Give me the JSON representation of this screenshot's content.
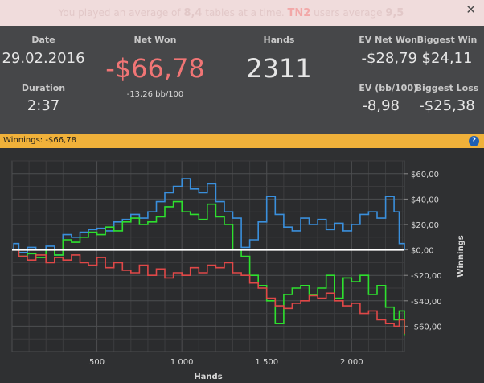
{
  "banner": {
    "pre": "You played an average of ",
    "avg_tables": "8,4",
    "mid": " tables at a time. ",
    "site": "TN2",
    "post": " users average ",
    "site_avg": "9,5"
  },
  "icons": {
    "close": "close-icon",
    "help": "help-icon"
  },
  "stats": {
    "date_label": "Date",
    "date": "29.02.2016",
    "duration_label": "Duration",
    "duration": "2:37",
    "net_won_label": "Net Won",
    "net_won": "-$66,78",
    "bb100": "-13,26 bb/100",
    "hands_label": "Hands",
    "hands": "2311",
    "ev_net_won_label": "EV Net Won",
    "ev_net_won": "-$28,79",
    "biggest_win_label": "Biggest Win",
    "biggest_win": "$24,11",
    "ev_bb_label": "EV (bb/100)",
    "ev_bb": "-8,98",
    "biggest_loss_label": "Biggest Loss",
    "biggest_loss": "-$25,38"
  },
  "winnings_bar": {
    "label": "Winnings:",
    "value": "-$66,78"
  },
  "colors": {
    "loss": "#f07575",
    "accent_bar": "#f0b13a",
    "blue": "#3a8fdc",
    "green": "#2ee02e",
    "red": "#e04848"
  },
  "chart_data": {
    "type": "line",
    "xlabel": "Hands",
    "ylabel": "Winnings",
    "xlim": [
      0,
      2311
    ],
    "ylim": [
      -80,
      70
    ],
    "x_ticks": [
      500,
      1000,
      1500,
      2000
    ],
    "x_tick_labels": [
      "500",
      "1 000",
      "1 500",
      "2 000"
    ],
    "y_ticks": [
      60,
      40,
      20,
      0,
      -20,
      -40,
      -60
    ],
    "y_tick_labels": [
      "$60,00",
      "$40,00",
      "$20,00",
      "$0,00",
      "-$20,00",
      "-$40,00",
      "-$60,00"
    ],
    "series": [
      {
        "color": "#3a8fdc",
        "x": [
          0,
          10,
          40,
          90,
          140,
          200,
          250,
          300,
          350,
          400,
          450,
          500,
          550,
          600,
          650,
          700,
          750,
          800,
          850,
          900,
          950,
          1000,
          1050,
          1100,
          1150,
          1200,
          1250,
          1300,
          1350,
          1400,
          1450,
          1500,
          1550,
          1600,
          1650,
          1700,
          1750,
          1800,
          1850,
          1900,
          1950,
          2000,
          2050,
          2100,
          2150,
          2200,
          2250,
          2280,
          2311
        ],
        "y": [
          0,
          5,
          -2,
          2,
          0,
          3,
          -4,
          12,
          10,
          14,
          16,
          17,
          15,
          22,
          24,
          28,
          25,
          30,
          38,
          45,
          50,
          56,
          48,
          45,
          52,
          38,
          30,
          25,
          2,
          8,
          22,
          42,
          28,
          18,
          15,
          25,
          20,
          24,
          16,
          21,
          15,
          20,
          28,
          30,
          25,
          42,
          30,
          5,
          0
        ]
      },
      {
        "color": "#2ee02e",
        "x": [
          0,
          40,
          90,
          140,
          200,
          250,
          300,
          350,
          400,
          450,
          500,
          550,
          600,
          650,
          700,
          750,
          800,
          850,
          900,
          950,
          1000,
          1050,
          1100,
          1150,
          1200,
          1250,
          1300,
          1350,
          1400,
          1450,
          1500,
          1550,
          1600,
          1650,
          1700,
          1750,
          1800,
          1850,
          1900,
          1950,
          2000,
          2050,
          2100,
          2150,
          2200,
          2250,
          2280,
          2311
        ],
        "y": [
          0,
          -5,
          -3,
          -6,
          0,
          -4,
          8,
          6,
          10,
          14,
          12,
          18,
          15,
          22,
          25,
          20,
          22,
          26,
          34,
          38,
          30,
          28,
          24,
          36,
          26,
          20,
          0,
          -5,
          -20,
          -28,
          -40,
          -58,
          -35,
          -30,
          -28,
          -35,
          -30,
          -20,
          -38,
          -22,
          -25,
          -20,
          -35,
          -28,
          -45,
          -55,
          -48,
          -67
        ]
      },
      {
        "color": "#e04848",
        "x": [
          0,
          40,
          90,
          140,
          200,
          250,
          300,
          350,
          400,
          450,
          500,
          550,
          600,
          650,
          700,
          750,
          800,
          850,
          900,
          950,
          1000,
          1050,
          1100,
          1150,
          1200,
          1250,
          1300,
          1350,
          1400,
          1450,
          1500,
          1550,
          1600,
          1650,
          1700,
          1750,
          1800,
          1850,
          1900,
          1950,
          2000,
          2050,
          2100,
          2150,
          2200,
          2250,
          2280,
          2311
        ],
        "y": [
          0,
          -5,
          -8,
          -4,
          -10,
          -6,
          -8,
          -4,
          -10,
          -12,
          -6,
          -14,
          -10,
          -16,
          -18,
          -12,
          -20,
          -15,
          -22,
          -18,
          -20,
          -14,
          -18,
          -12,
          -14,
          -10,
          -18,
          -20,
          -26,
          -30,
          -38,
          -44,
          -46,
          -42,
          -40,
          -36,
          -38,
          -34,
          -40,
          -44,
          -42,
          -50,
          -48,
          -55,
          -58,
          -60,
          -55,
          -66
        ]
      }
    ]
  }
}
